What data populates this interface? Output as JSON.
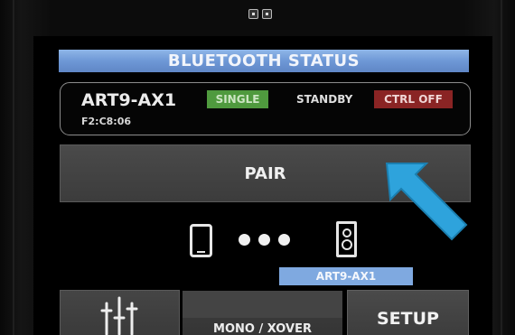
{
  "title": "BLUETOOTH STATUS",
  "device": {
    "name": "ART9-AX1",
    "address": "F2:C8:06",
    "mode_badge": "SINGLE",
    "state": "STANDBY",
    "control_badge": "CTRL OFF"
  },
  "pair_label": "PAIR",
  "connected_device_label": "ART9-AX1",
  "bottom_buttons": {
    "mixer_icon": "mixer-sliders-icon",
    "mono_label": "MONO / XOVER",
    "setup_label": "SETUP"
  },
  "icons": [
    "phone-icon",
    "connection-dots-icon",
    "speaker-icon",
    "pointer-arrow-icon"
  ],
  "colors": {
    "title_bar": "#6e98d6",
    "single_badge": "#4f9a3e",
    "ctrl_off_badge": "#8a2424",
    "device_chip": "#7fa9e0",
    "arrow": "#2ea3dc"
  }
}
